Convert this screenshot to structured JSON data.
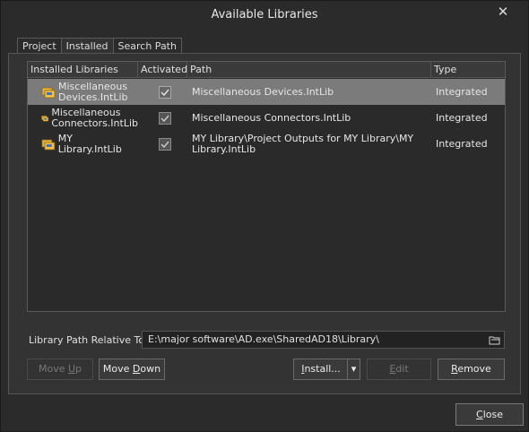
{
  "window": {
    "title": "Available Libraries",
    "close_glyph": "✕"
  },
  "tabs": [
    {
      "label": "Project",
      "active": false
    },
    {
      "label": "Installed",
      "active": true
    },
    {
      "label": "Search Path",
      "active": false
    }
  ],
  "table": {
    "columns": [
      "Installed Libraries",
      "Activated",
      "Path",
      "Type"
    ],
    "rows": [
      {
        "name_line1": "Miscellaneous",
        "name_line2": "Devices.IntLib",
        "activated": true,
        "path_line1": "Miscellaneous Devices.IntLib",
        "path_line2": "",
        "type": "Integrated",
        "selected": true
      },
      {
        "name_line1": "Miscellaneous",
        "name_line2": "Connectors.IntLib",
        "activated": true,
        "path_line1": "Miscellaneous Connectors.IntLib",
        "path_line2": "",
        "type": "Integrated",
        "selected": false
      },
      {
        "name_line1": "MY Library.IntLib",
        "name_line2": "",
        "activated": true,
        "path_line1": "MY Library\\Project Outputs for MY Library\\MY",
        "path_line2": "Library.IntLib",
        "type": "Integrated",
        "selected": false
      }
    ],
    "row_icon": "library-icon",
    "check_icon": "checkmark-icon"
  },
  "library_path": {
    "label": "Library Path Relative To:",
    "value": "E:\\major  software\\AD.exe\\SharedAD18\\Library\\",
    "icon": "folder-icon"
  },
  "buttons": {
    "move_up": {
      "pre": "Move ",
      "u": "U",
      "post": "p",
      "enabled": false
    },
    "move_down": {
      "pre": "Move ",
      "u": "D",
      "post": "own",
      "enabled": true
    },
    "install": {
      "pre": "",
      "u": "I",
      "post": "nstall...",
      "enabled": true
    },
    "install_arrow": "▾",
    "edit": {
      "pre": "",
      "u": "E",
      "post": "dit",
      "enabled": false
    },
    "remove": {
      "pre": "",
      "u": "R",
      "post": "emove",
      "enabled": true
    },
    "close": {
      "pre": "",
      "u": "C",
      "post": "lose",
      "enabled": true
    }
  },
  "colors": {
    "background": "#2b2b2b",
    "selected_row": "#7b7b7b",
    "text": "#e6e6e6",
    "disabled_text": "#777777"
  }
}
